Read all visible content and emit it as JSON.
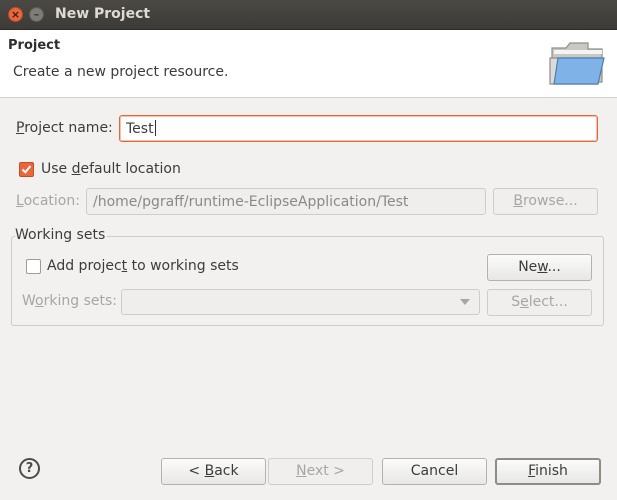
{
  "window": {
    "title": "New Project"
  },
  "header": {
    "title": "Project",
    "description": "Create a new project resource.",
    "icon": "folder-icon"
  },
  "project_name": {
    "label_mnemonic": "P",
    "label_rest": "roject name:",
    "value": "Test"
  },
  "use_default_location": {
    "label_pre": "Use ",
    "label_mnemonic": "d",
    "label_post": "efault location",
    "checked": true
  },
  "location": {
    "label_mnemonic": "L",
    "label_rest": "ocation:",
    "value": "/home/pgraff/runtime-EclipseApplication/Test",
    "browse_pre": "",
    "browse_mnemonic": "B",
    "browse_post": "rowse..."
  },
  "working_sets": {
    "group_title": "Working sets",
    "add_pre": "Add projec",
    "add_mnemonic": "t",
    "add_post": " to working sets",
    "add_checked": false,
    "new_pre": "Ne",
    "new_mnemonic": "w",
    "new_post": "...",
    "label_pre": "W",
    "label_mnemonic": "o",
    "label_post": "rking sets:",
    "select_pre": "S",
    "select_mnemonic": "e",
    "select_post": "lect...",
    "selected": ""
  },
  "footer": {
    "help_icon": "help-icon",
    "back": "< Back",
    "back_mnemonic": "B",
    "back_pre": "< ",
    "back_post": "ack",
    "next_pre": "",
    "next_mnemonic": "N",
    "next_post": "ext >",
    "cancel": "Cancel",
    "finish_pre": "",
    "finish_mnemonic": "F",
    "finish_post": "inish"
  },
  "colors": {
    "accent": "#e9673b",
    "titlebar": "#3c3b37",
    "background": "#f2f1f0"
  }
}
